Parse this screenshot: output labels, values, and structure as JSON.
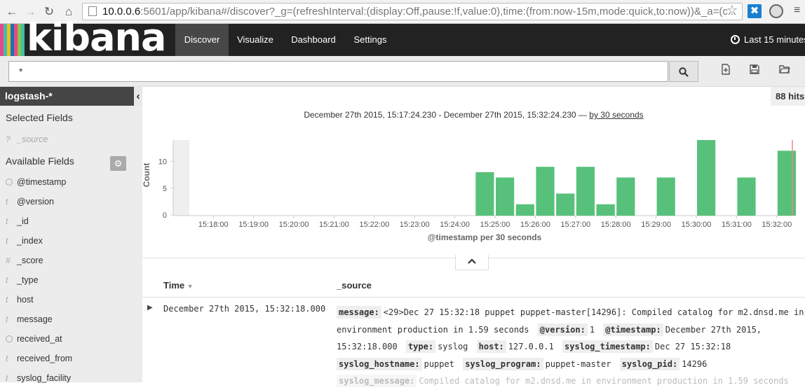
{
  "browser": {
    "url_host": "10.0.0.6",
    "url_rest": ":5601/app/kibana#/discover?_g=(refreshInterval:(display:Off,pause:!f,value:0),time:(from:now-15m,mode:quick,to:now))&_a=(c..."
  },
  "brand": {
    "logo_text": "kibana",
    "stripe_colors": [
      "#e8478b",
      "#3ebeb0",
      "#f4bd19",
      "#0e76bc",
      "#e8478b",
      "#8dc63f",
      "#3ebeb0"
    ]
  },
  "nav": {
    "tabs": [
      {
        "label": "Discover",
        "active": true
      },
      {
        "label": "Visualize",
        "active": false
      },
      {
        "label": "Dashboard",
        "active": false
      },
      {
        "label": "Settings",
        "active": false
      }
    ],
    "timepicker_label": "Last 15 minutes"
  },
  "search": {
    "query": "*"
  },
  "sidebar": {
    "index_pattern": "logstash-*",
    "selected_heading": "Selected Fields",
    "selected_fields": [
      {
        "type": "?",
        "name": "_source"
      }
    ],
    "available_heading": "Available Fields",
    "available_fields": [
      {
        "type": "clock",
        "name": "@timestamp"
      },
      {
        "type": "t",
        "name": "@version"
      },
      {
        "type": "t",
        "name": "_id"
      },
      {
        "type": "t",
        "name": "_index"
      },
      {
        "type": "#",
        "name": "_score"
      },
      {
        "type": "t",
        "name": "_type"
      },
      {
        "type": "t",
        "name": "host"
      },
      {
        "type": "t",
        "name": "message"
      },
      {
        "type": "clock",
        "name": "received_at"
      },
      {
        "type": "t",
        "name": "received_from"
      },
      {
        "type": "t",
        "name": "syslog_facility"
      }
    ]
  },
  "main": {
    "hits_label": "88 hits",
    "range_text": "December 27th 2015, 15:17:24.230 - December 27th 2015, 15:32:24.230 —",
    "interval_link": "by 30 seconds",
    "columns": {
      "time": "Time",
      "source": "_source"
    },
    "row": {
      "time": "December 27th 2015, 15:32:18.000"
    },
    "source_pairs": [
      {
        "k": "message:",
        "v": "<29>Dec 27 15:32:18 puppet puppet-master[14296]: Compiled catalog for m2.dnsd.me in environment production in 1.59 seconds"
      },
      {
        "k": "@version:",
        "v": "1"
      },
      {
        "k": "@timestamp:",
        "v": "December 27th 2015, 15:32:18.000"
      },
      {
        "k": "type:",
        "v": "syslog"
      },
      {
        "k": "host:",
        "v": "127.0.0.1"
      },
      {
        "k": "syslog_timestamp:",
        "v": "Dec 27 15:32:18"
      },
      {
        "k": "syslog_hostname:",
        "v": "puppet"
      },
      {
        "k": "syslog_program:",
        "v": "puppet-master"
      },
      {
        "k": "syslog_pid:",
        "v": "14296"
      },
      {
        "k": "syslog_message:",
        "v": "Compiled catalog for m2.dnsd.me in environment production in 1.59 seconds"
      }
    ]
  },
  "chart_data": {
    "type": "bar",
    "ylabel": "Count",
    "xlabel": "@timestamp per 30 seconds",
    "ylim": [
      0,
      14
    ],
    "y_ticks": [
      0,
      5,
      10
    ],
    "x_tick_labels": [
      "15:18:00",
      "15:19:00",
      "15:20:00",
      "15:21:00",
      "15:22:00",
      "15:23:00",
      "15:24:00",
      "15:25:00",
      "15:26:00",
      "15:27:00",
      "15:28:00",
      "15:29:00",
      "15:30:00",
      "15:31:00",
      "15:32:00"
    ],
    "bars": [
      {
        "x": "15:24:30",
        "value": 8
      },
      {
        "x": "15:25:00",
        "value": 7
      },
      {
        "x": "15:25:30",
        "value": 2
      },
      {
        "x": "15:26:00",
        "value": 9
      },
      {
        "x": "15:26:30",
        "value": 4
      },
      {
        "x": "15:27:00",
        "value": 9
      },
      {
        "x": "15:27:30",
        "value": 2
      },
      {
        "x": "15:28:00",
        "value": 7
      },
      {
        "x": "15:29:00",
        "value": 7
      },
      {
        "x": "15:30:00",
        "value": 14
      },
      {
        "x": "15:31:00",
        "value": 7
      },
      {
        "x": "15:32:00",
        "value": 12
      }
    ],
    "bar_color": "#57c17b"
  }
}
